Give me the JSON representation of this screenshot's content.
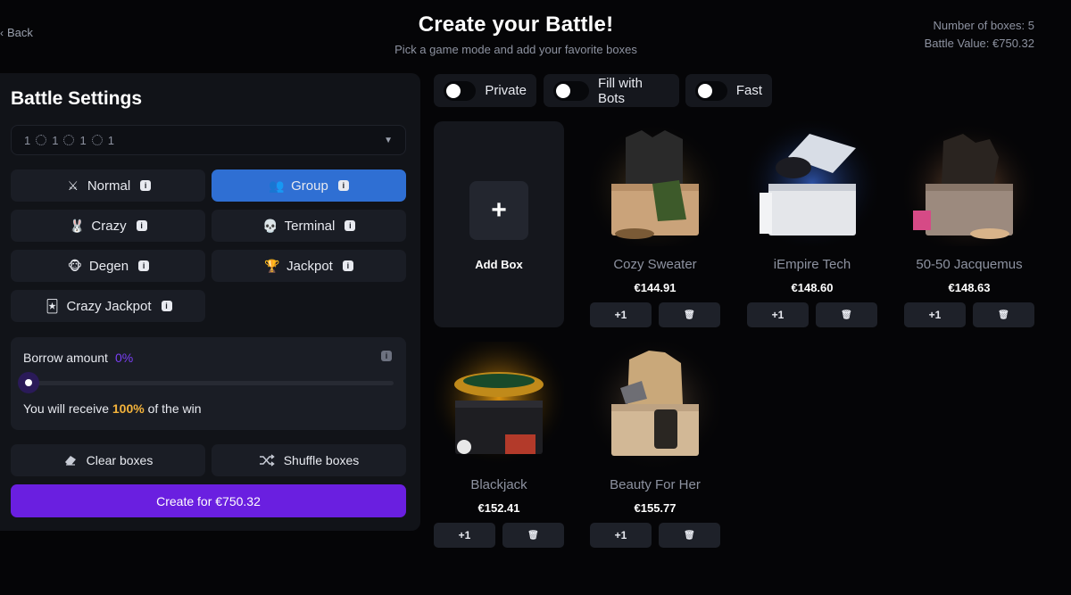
{
  "header": {
    "back_label": "Back",
    "title": "Create your Battle!",
    "subtitle": "Pick a game mode and add your favorite boxes",
    "boxes_count_label": "Number of boxes: 5",
    "battle_value_label": "Battle Value: €750.32"
  },
  "settings": {
    "title": "Battle Settings",
    "team_format": [
      "1",
      "1",
      "1",
      "1"
    ],
    "modes": [
      {
        "label": "Normal",
        "icon": "crossed-swords-icon",
        "active": false
      },
      {
        "label": "Group",
        "icon": "group-icon",
        "active": true
      },
      {
        "label": "Crazy",
        "icon": "bunny-icon",
        "active": false
      },
      {
        "label": "Terminal",
        "icon": "skull-icon",
        "active": false
      },
      {
        "label": "Degen",
        "icon": "monkey-icon",
        "active": false
      },
      {
        "label": "Jackpot",
        "icon": "trophy-icon",
        "active": false
      },
      {
        "label": "Crazy Jackpot",
        "icon": "jester-icon",
        "active": false
      }
    ],
    "borrow": {
      "label": "Borrow amount",
      "percent": "0%",
      "slider_value": 0,
      "receive_prefix": "You will receive",
      "receive_value": "100%",
      "receive_suffix": "of the win"
    },
    "clear_label": "Clear boxes",
    "shuffle_label": "Shuffle boxes",
    "create_label": "Create for €750.32"
  },
  "toggles": [
    {
      "label": "Private",
      "on": false
    },
    {
      "label": "Fill with Bots",
      "on": false
    },
    {
      "label": "Fast",
      "on": false
    }
  ],
  "add_box_label": "Add Box",
  "add_one_label": "+1",
  "boxes": [
    {
      "name": "Cozy Sweater",
      "price": "€144.91",
      "glow": "#8a6a3a"
    },
    {
      "name": "iEmpire Tech",
      "price": "€148.60",
      "glow": "#3a6ad8"
    },
    {
      "name": "50-50 Jacquemus",
      "price": "€148.63",
      "glow": "#d08a5a"
    },
    {
      "name": "Blackjack",
      "price": "€152.41",
      "glow": "#f0a010"
    },
    {
      "name": "Beauty For Her",
      "price": "€155.77",
      "glow": "#9a7a5a"
    }
  ],
  "colors": {
    "accent_purple": "#6a1fe0",
    "active_blue": "#2f6fd3",
    "highlight_gold": "#f4b33b"
  }
}
